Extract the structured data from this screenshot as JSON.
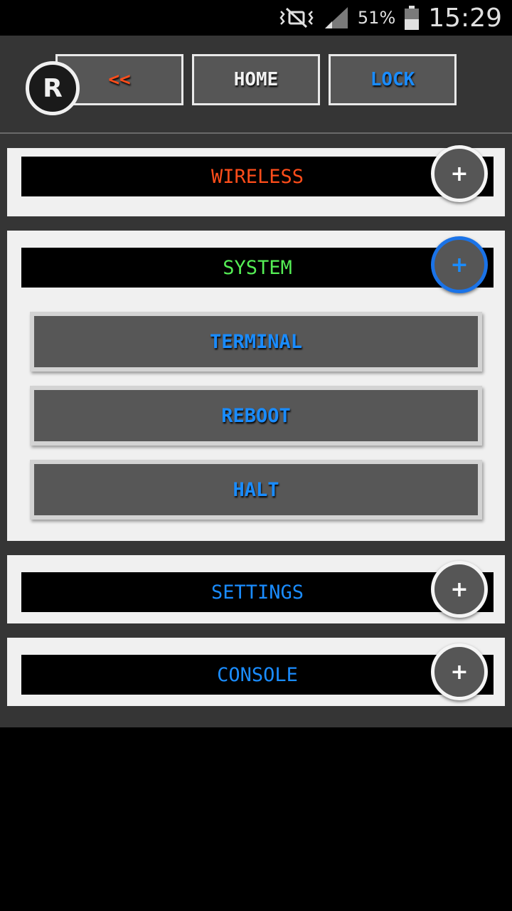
{
  "status_bar": {
    "battery_percent": "51%",
    "time": "15:29",
    "icons": [
      "mute-vibrate-icon",
      "signal-icon",
      "battery-icon"
    ]
  },
  "topbar": {
    "logo_letter": "R",
    "back_label": "<<",
    "home_label": "HOME",
    "lock_label": "LOCK"
  },
  "sections": {
    "wireless": {
      "title": "WIRELESS",
      "toggle": "+"
    },
    "system": {
      "title": "SYSTEM",
      "toggle": "+",
      "items": [
        {
          "label": "TERMINAL"
        },
        {
          "label": "REBOOT"
        },
        {
          "label": "HALT"
        }
      ]
    },
    "settings": {
      "title": "SETTINGS",
      "toggle": "+"
    },
    "console": {
      "title": "CONSOLE",
      "toggle": "+"
    }
  },
  "colors": {
    "wireless": "#ff4d1a",
    "system": "#55ee55",
    "accent_blue": "#1a8cff",
    "panel": "#f0f0f0",
    "background": "#353535"
  }
}
